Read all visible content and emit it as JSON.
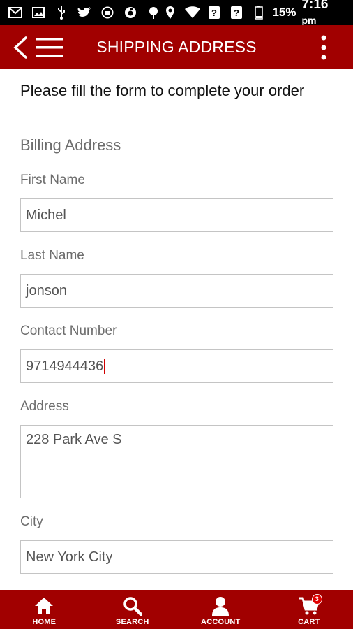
{
  "status_bar": {
    "battery_percent": "15%",
    "time": "7:16",
    "time_suffix": "pm",
    "icons": [
      "gmail-icon",
      "image-icon",
      "usb-icon",
      "twitter-icon",
      "vpn-icon",
      "app-icon",
      "android-icon",
      "location-icon",
      "wifi-icon",
      "sim-icon",
      "sim-icon",
      "battery-icon"
    ]
  },
  "app_bar": {
    "title": "SHIPPING ADDRESS",
    "icons": [
      "back-arrow-icon",
      "hamburger-menu-icon",
      "more-vert-icon"
    ]
  },
  "form": {
    "intro": "Please fill the form to complete your order",
    "section_title": "Billing Address",
    "first_name": {
      "label": "First Name",
      "value": "Michel"
    },
    "last_name": {
      "label": "Last Name",
      "value": "jonson"
    },
    "contact": {
      "label": "Contact Number",
      "value": "9714944436"
    },
    "address": {
      "label": "Address",
      "value": "228 Park Ave S"
    },
    "city": {
      "label": "City",
      "value": "New York City"
    }
  },
  "bottom_nav": {
    "items": [
      {
        "label": "HOME",
        "icon": "home-icon"
      },
      {
        "label": "SEARCH",
        "icon": "search-icon"
      },
      {
        "label": "ACCOUNT",
        "icon": "account-icon"
      },
      {
        "label": "CART",
        "icon": "cart-icon",
        "badge": "3"
      }
    ]
  },
  "colors": {
    "primary": "#a10000",
    "status_bar": "#000000",
    "caret": "#d00000"
  }
}
